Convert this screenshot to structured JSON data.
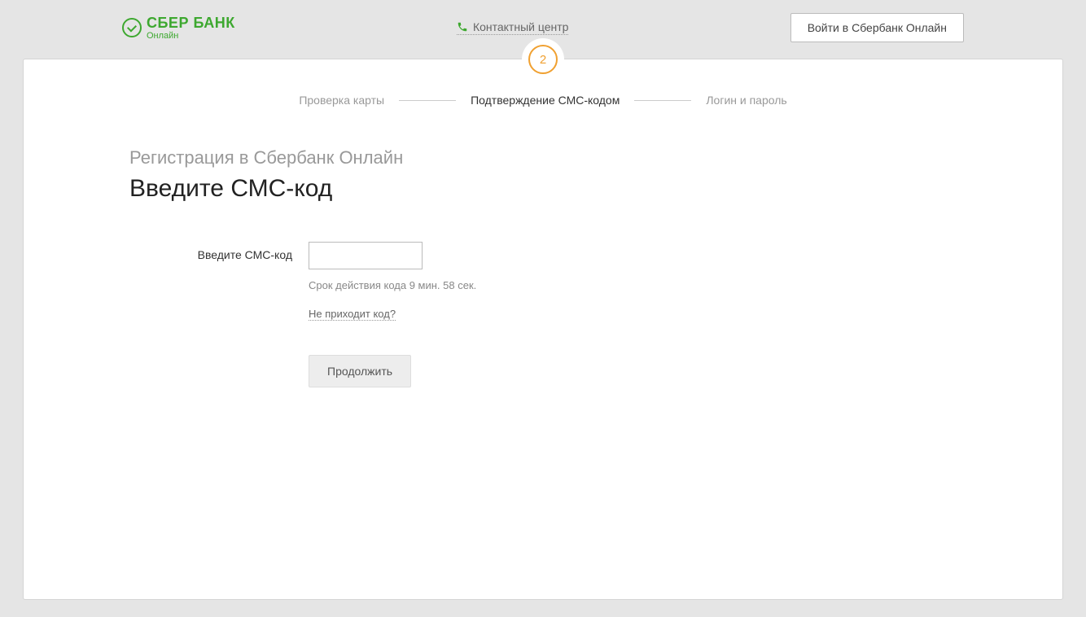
{
  "header": {
    "logo_main": "СБЕР БАНК",
    "logo_sub": "Онлайн",
    "contact_label": "Контактный центр",
    "login_button": "Войти в Сбербанк Онлайн"
  },
  "stepper": {
    "current_number": "2",
    "steps": [
      {
        "label": "Проверка карты",
        "active": false
      },
      {
        "label": "Подтверждение СМС-кодом",
        "active": true
      },
      {
        "label": "Логин и пароль",
        "active": false
      }
    ]
  },
  "page": {
    "subtitle": "Регистрация в Сбербанк Онлайн",
    "title": "Введите СМС-код"
  },
  "form": {
    "sms_label": "Введите СМС-код",
    "sms_value": "",
    "timer_text": "Срок действия кода 9 мин. 58 сек.",
    "help_link": "Не приходит код?",
    "submit_label": "Продолжить"
  }
}
